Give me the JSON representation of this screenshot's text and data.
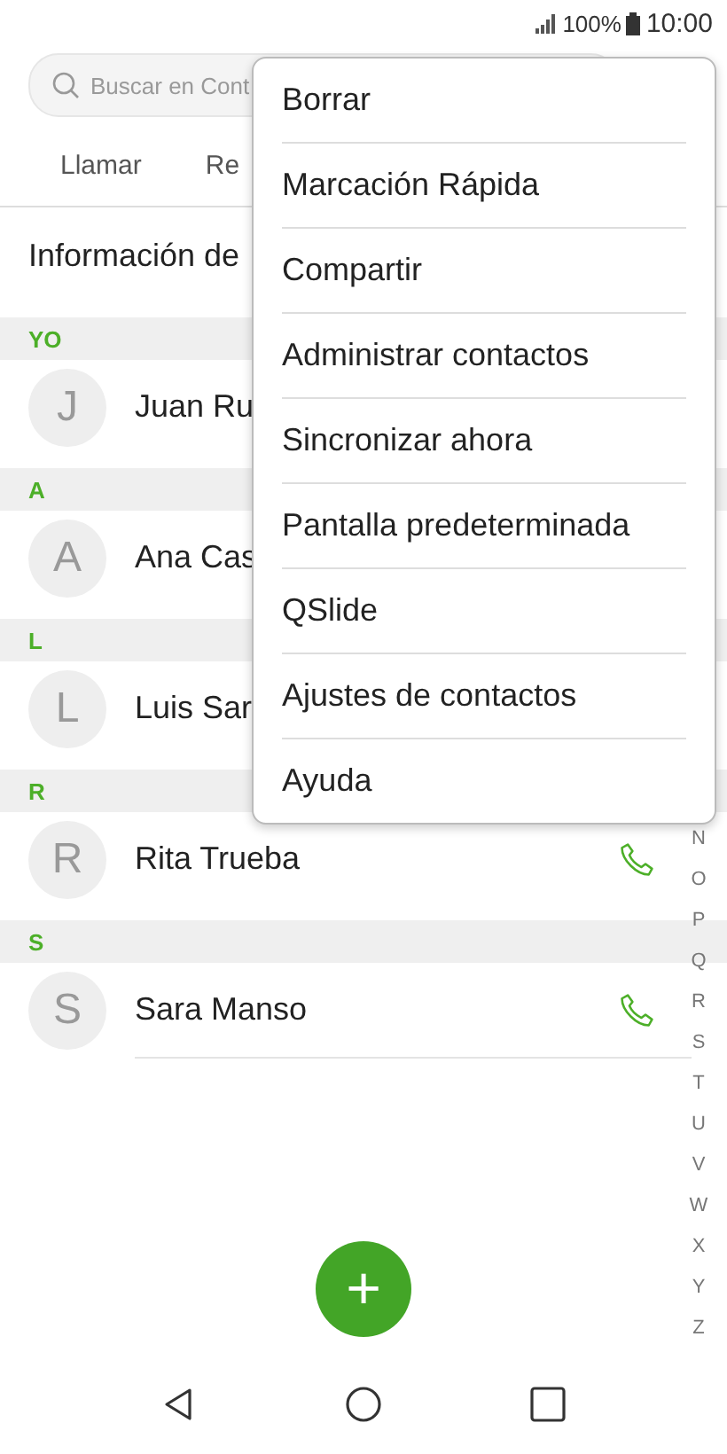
{
  "status_bar": {
    "battery": "100%",
    "time": "10:00"
  },
  "search": {
    "placeholder": "Buscar en Cont"
  },
  "tabs": [
    {
      "label": "Llamar"
    },
    {
      "label": "Re"
    }
  ],
  "profile_header": "Información de",
  "sections": [
    {
      "letter": "YO",
      "contacts": [
        {
          "initial": "J",
          "name": "Juan Ru",
          "call_button": false
        }
      ]
    },
    {
      "letter": "A",
      "contacts": [
        {
          "initial": "A",
          "name": "Ana Cas",
          "call_button": false
        }
      ]
    },
    {
      "letter": "L",
      "contacts": [
        {
          "initial": "L",
          "name": "Luis Sar",
          "call_button": false
        }
      ]
    },
    {
      "letter": "R",
      "contacts": [
        {
          "initial": "R",
          "name": "Rita Trueba",
          "call_button": true
        }
      ]
    },
    {
      "letter": "S",
      "contacts": [
        {
          "initial": "S",
          "name": "Sara Manso",
          "call_button": true
        }
      ]
    }
  ],
  "index_letters": [
    "N",
    "O",
    "P",
    "Q",
    "R",
    "S",
    "T",
    "U",
    "V",
    "W",
    "X",
    "Y",
    "Z"
  ],
  "menu": [
    "Borrar",
    "Marcación Rápida",
    "Compartir",
    "Administrar contactos",
    "Sincronizar ahora",
    "Pantalla predeterminada",
    "QSlide",
    "Ajustes de contactos",
    "Ayuda"
  ],
  "fab": "+"
}
